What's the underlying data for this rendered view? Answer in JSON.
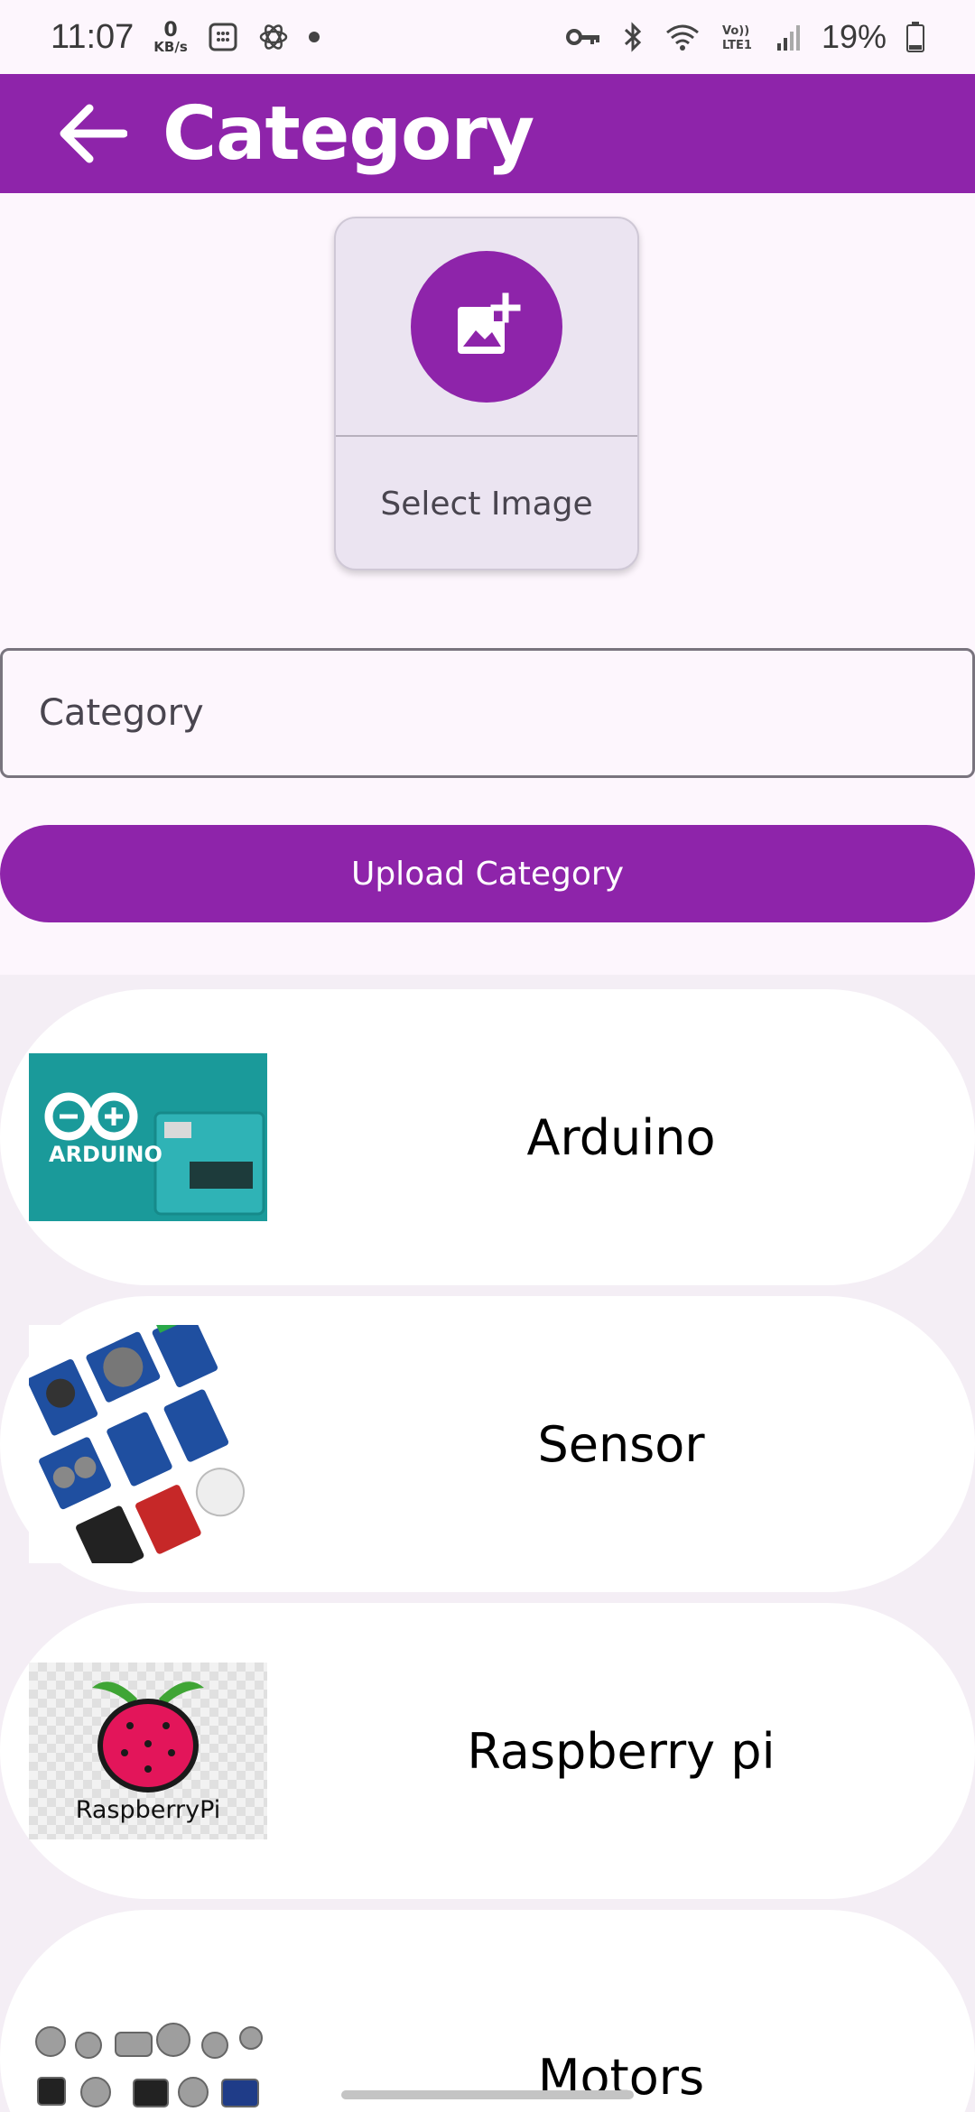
{
  "status_bar": {
    "time": "11:07",
    "net_speed_value": "0",
    "net_speed_unit": "KB/s",
    "network_label": "Vo)) LTE1",
    "battery_percent": "19%"
  },
  "app_bar": {
    "title": "Category",
    "back_icon": "arrow-left-icon"
  },
  "image_picker": {
    "icon": "add-photo-icon",
    "label": "Select Image"
  },
  "category_field": {
    "placeholder": "Category",
    "value": ""
  },
  "upload_button": {
    "label": "Upload Category"
  },
  "categories": [
    {
      "name": "Arduino",
      "thumb_text": "ARDUINO"
    },
    {
      "name": "Sensor"
    },
    {
      "name": "Raspberry pi",
      "thumb_text": "RaspberryPi"
    },
    {
      "name": "Motors"
    }
  ],
  "colors": {
    "primary": "#8e24aa",
    "background": "#fdf6fd",
    "on_primary": "#ffffff"
  }
}
